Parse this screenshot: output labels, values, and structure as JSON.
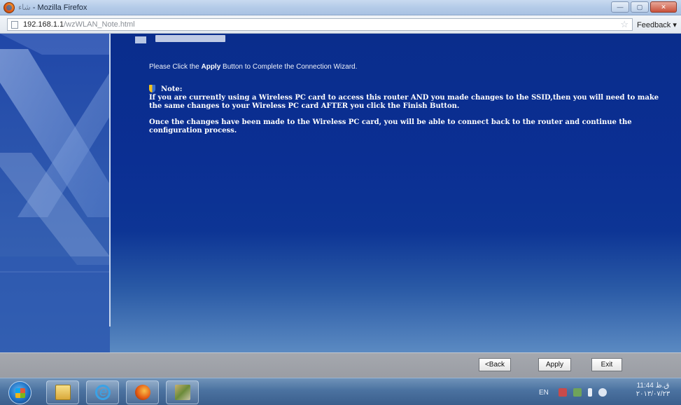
{
  "window": {
    "title_garbled": "ﺷﺎﺀ",
    "title": " - Mozilla Firefox",
    "controls": [
      "minimize",
      "maximize",
      "close"
    ]
  },
  "address_bar": {
    "url_host": "192.168.1.1",
    "url_path": "/wzWLAN_Note.html",
    "feedback_label": "Feedback ▾"
  },
  "page": {
    "instruction_prefix": "Please Click the ",
    "instruction_bold": "Apply",
    "instruction_suffix": " Button to Complete the Connection Wizard.",
    "note_label": "Note:",
    "note_paragraph_1": "If you are currently using a Wireless PC card to access this router AND you made changes to the SSID,then you will need to make the same changes to your Wireless PC card AFTER you click the Finish Button.",
    "note_paragraph_2": "Once the changes have been made to the Wireless PC card, you will be able to connect back to the router and continue the configuration process."
  },
  "buttons": {
    "back": "<Back",
    "apply": "Apply",
    "exit": "Exit"
  },
  "taskbar": {
    "apps": [
      "start-orb",
      "windows-explorer-icon",
      "internet-explorer-icon",
      "firefox-icon",
      "tool-icon"
    ],
    "language": "EN",
    "clock_time": "11:44 ﻕ.ﻅ",
    "clock_date": "٢٠١٣/٠٧/٢٣"
  }
}
